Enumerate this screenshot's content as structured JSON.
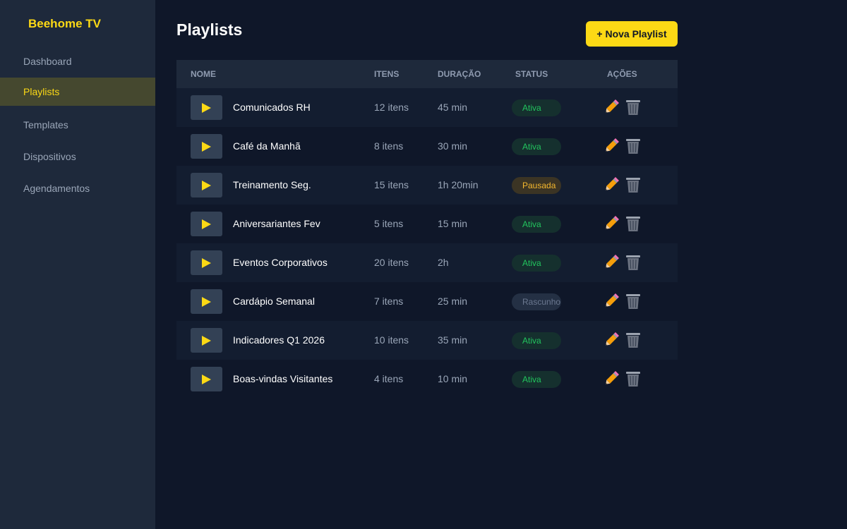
{
  "app": {
    "brand": "Beehome TV"
  },
  "sidebar": {
    "items": [
      {
        "label": "Dashboard",
        "active": false
      },
      {
        "label": "Playlists",
        "active": true
      },
      {
        "label": "Templates",
        "active": false
      },
      {
        "label": "Dispositivos",
        "active": false
      },
      {
        "label": "Agendamentos",
        "active": false
      }
    ]
  },
  "header": {
    "title": "Playlists",
    "new_button_label": "+ Nova Playlist"
  },
  "table": {
    "columns": [
      "Nome",
      "Itens",
      "Duração",
      "Status",
      "Ações"
    ],
    "rows": [
      {
        "name": "Comunicados RH",
        "items": "12 itens",
        "duration": "45 min",
        "status": "Ativa",
        "status_kind": "ativa"
      },
      {
        "name": "Café da Manhã",
        "items": "8 itens",
        "duration": "30 min",
        "status": "Ativa",
        "status_kind": "ativa"
      },
      {
        "name": "Treinamento Seg.",
        "items": "15 itens",
        "duration": "1h 20min",
        "status": "Pausada",
        "status_kind": "pausada"
      },
      {
        "name": "Aniversariantes Fev",
        "items": "5 itens",
        "duration": "15 min",
        "status": "Ativa",
        "status_kind": "ativa"
      },
      {
        "name": "Eventos Corporativos",
        "items": "20 itens",
        "duration": "2h",
        "status": "Ativa",
        "status_kind": "ativa"
      },
      {
        "name": "Cardápio Semanal",
        "items": "7 itens",
        "duration": "25 min",
        "status": "Rascunho",
        "status_kind": "rascunho"
      },
      {
        "name": "Indicadores Q1 2026",
        "items": "10 itens",
        "duration": "35 min",
        "status": "Ativa",
        "status_kind": "ativa"
      },
      {
        "name": "Boas-vindas Visitantes",
        "items": "4 itens",
        "duration": "10 min",
        "status": "Ativa",
        "status_kind": "ativa"
      }
    ],
    "row_icons": {
      "play": "play-icon",
      "edit": "pencil-icon",
      "delete": "trash-icon"
    }
  },
  "colors": {
    "accent": "#fcd915",
    "background": "#0f1729",
    "sidebar": "#1e293b",
    "status_active": "#22c55e",
    "status_paused": "#f5b82e",
    "status_draft": "#6b7890"
  }
}
